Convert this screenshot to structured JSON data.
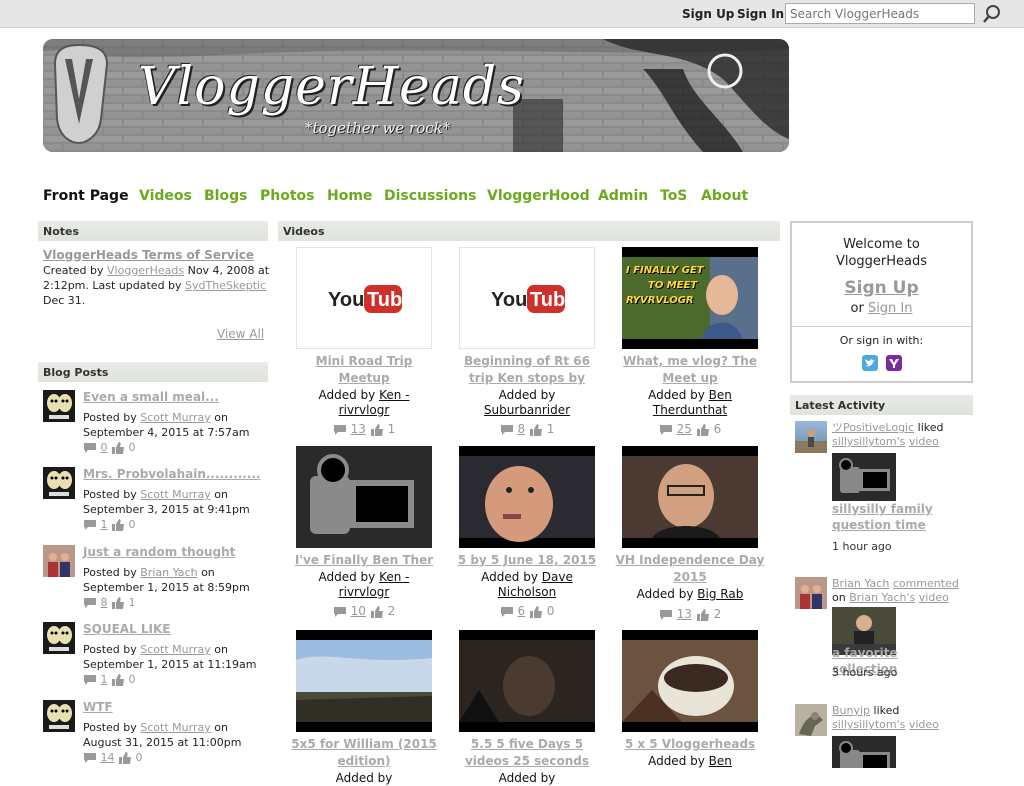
{
  "topbar": {
    "sign_up": "Sign Up",
    "sign_in": "Sign In",
    "search_placeholder": "Search VloggerHeads"
  },
  "banner": {
    "logo_letter": "V",
    "site_name": "VloggerHeads",
    "tagline": "*together we rock*"
  },
  "nav": [
    "Front Page",
    "Videos",
    "Blogs",
    "Photos",
    "Home",
    "Discussions",
    "VloggerHood",
    "Admin",
    "ToS",
    "About"
  ],
  "notes": {
    "heading": "Notes",
    "title": "VloggerHeads Terms of Service",
    "created_by": "Created by",
    "author": "VloggerHeads",
    "date": "Nov 4, 2008",
    "time": "at 2:12pm.",
    "updated": "Last updated by",
    "updater": "SydTheSkeptic",
    "updated_date": "Dec 31.",
    "view_all": "View All"
  },
  "blog": {
    "heading": "Blog Posts",
    "posted_by": "Posted by",
    "on": "on",
    "posts": [
      {
        "title": "Even a small meal...",
        "author": "Scott Murray",
        "date": "September 4, 2015 at 7:57am",
        "comments": "0",
        "likes": "0"
      },
      {
        "title": "Mrs. Probvolahain............",
        "author": "Scott Murray",
        "date": "September 3, 2015 at 9:41pm",
        "comments": "1",
        "likes": "0"
      },
      {
        "title": "Just a random thought",
        "author": "Brian Yach",
        "date": "September 1, 2015 at 8:59pm",
        "comments": "8",
        "likes": "1"
      },
      {
        "title": "SQUEAL LIKE",
        "author": "Scott Murray",
        "date": "September 1, 2015 at 11:19am",
        "comments": "1",
        "likes": "0"
      },
      {
        "title": "WTF",
        "author": "Scott Murray",
        "date": "August 31, 2015 at 11:00pm",
        "comments": "14",
        "likes": "0"
      }
    ]
  },
  "videos": {
    "heading": "Videos",
    "added_by": "Added by",
    "items": [
      {
        "title1": "Mini Road Trip",
        "title2": "Meetup",
        "by1": "Ken -",
        "by2": "rivrvlogr",
        "comments": "13",
        "likes": "1",
        "thumb": "youtube"
      },
      {
        "title1": "Beginning of Rt 66",
        "title2": "trip Ken stops by",
        "by1": "",
        "by2": "Suburbanrider",
        "comments": "8",
        "likes": "1",
        "thumb": "youtube"
      },
      {
        "title1": "What, me vlog? The",
        "title2": "Meet up",
        "by1": "Ben",
        "by2": "Therdunthat",
        "comments": "25",
        "likes": "6",
        "thumb": "meet",
        "thumb_text1": "I FINALLY GET",
        "thumb_text2": "TO MEET",
        "thumb_text3": "RYVRVLOGR"
      },
      {
        "title1": "I've Finally Ben Ther",
        "title2": "",
        "by1": "Ken -",
        "by2": "rivrvlogr",
        "comments": "10",
        "likes": "2",
        "thumb": "camera"
      },
      {
        "title1": "5 by 5 June 18, 2015",
        "title2": "",
        "by1": "Dave",
        "by2": "Nicholson",
        "comments": "6",
        "likes": "0",
        "thumb": "face1"
      },
      {
        "title1": "VH Independence Day",
        "title2": "2015",
        "by1": "Big Rab",
        "by2": "",
        "comments": "13",
        "likes": "2",
        "thumb": "face2"
      },
      {
        "title1": "5x5 for William (2015",
        "title2": "edition)",
        "by1": "",
        "by2": "",
        "comments": "",
        "likes": "",
        "thumb": "sky"
      },
      {
        "title1": "5.5 5 five Days 5",
        "title2": "videos 25 seconds",
        "by1": "",
        "by2": "",
        "comments": "",
        "likes": "",
        "thumb": "dark"
      },
      {
        "title1": "5 x 5 Vloggerheads",
        "title2": "",
        "by1": "Ben",
        "by2": "",
        "comments": "",
        "likes": "",
        "thumb": "mug"
      }
    ]
  },
  "welcome": {
    "line1": "Welcome to",
    "line2": "VloggerHeads",
    "sign_up": "Sign Up",
    "or": "or",
    "sign_in": "Sign In",
    "or_sign_in_with": "Or sign in with:"
  },
  "activity": {
    "heading": "Latest Activity",
    "items": [
      {
        "user": "ツPositiveLogic",
        "action": "liked",
        "target": "sillysillytom's",
        "kind": "video",
        "title": "sillysilly family question time",
        "time": "1 hour ago"
      },
      {
        "user": "Brian Yach",
        "action": "commented",
        "target": "Brian Yach's",
        "kind": "video",
        "title": "a favorite collection",
        "time": "3 hours ago",
        "on": "on"
      },
      {
        "user": "Bunyip",
        "action": "liked",
        "target": "sillysillytom's",
        "kind": "video"
      }
    ]
  },
  "colors": {
    "nav_green": "#6aaa1e",
    "link_gray": "#999999",
    "section_bg": "#e3e6e0"
  }
}
